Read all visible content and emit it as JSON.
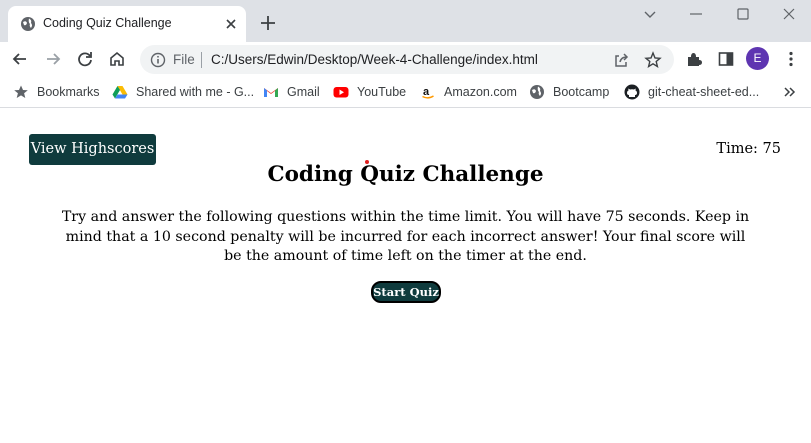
{
  "browser": {
    "tab": {
      "title": "Coding Quiz Challenge",
      "favicon": "globe-icon"
    },
    "address": {
      "scheme_label": "File",
      "url": "C:/Users/Edwin/Desktop/Week-4-Challenge/index.html"
    },
    "profile_initial": "E",
    "profile_color": "#5e35b1",
    "bookmarks": [
      {
        "label": "Bookmarks",
        "icon": "star-icon"
      },
      {
        "label": "Shared with me - G...",
        "icon": "google-drive-icon"
      },
      {
        "label": "Gmail",
        "icon": "gmail-icon"
      },
      {
        "label": "YouTube",
        "icon": "youtube-icon"
      },
      {
        "label": "Amazon.com",
        "icon": "amazon-icon"
      },
      {
        "label": "Bootcamp",
        "icon": "globe-icon"
      },
      {
        "label": "git-cheat-sheet-ed...",
        "icon": "github-icon"
      }
    ]
  },
  "page": {
    "highscores_label": "View Highscores",
    "timer_label": "Time: 75",
    "title": "Coding Quiz Challenge",
    "intro": "Try and answer the following questions within the time limit. You will have 75 seconds. Keep in mind that a 10 second penalty will be incurred for each incorrect answer! Your final score will be the amount of time left on the timer at the end.",
    "start_label": "Start Quiz",
    "accent_color": "#0f3b3d"
  }
}
